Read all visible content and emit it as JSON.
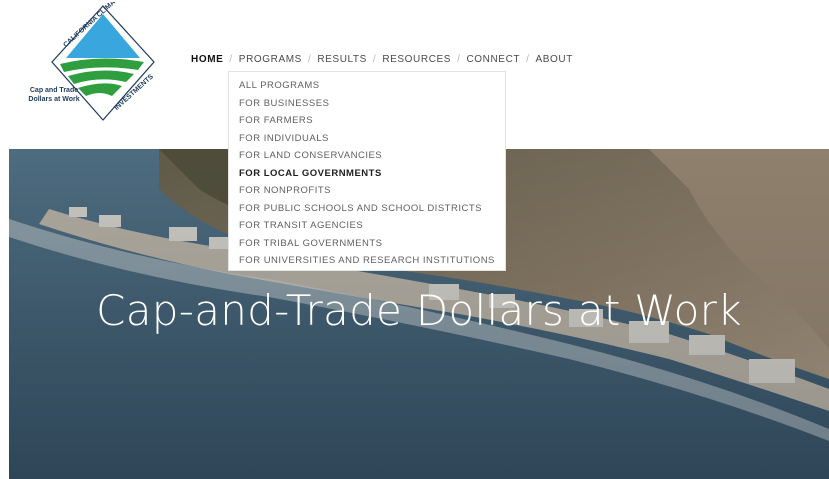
{
  "logo": {
    "name_top": "CALIFORNIA CLIMATE",
    "name_bottom": "INVESTMENTS",
    "tagline_line1": "Cap and Trade",
    "tagline_line2": "Dollars at Work"
  },
  "nav": {
    "items": [
      {
        "label": "HOME",
        "active": true
      },
      {
        "label": "PROGRAMS"
      },
      {
        "label": "RESULTS"
      },
      {
        "label": "RESOURCES"
      },
      {
        "label": "CONNECT"
      },
      {
        "label": "ABOUT"
      }
    ],
    "separator": "/"
  },
  "programs_menu": {
    "items": [
      "ALL PROGRAMS",
      "FOR BUSINESSES",
      "FOR FARMERS",
      "FOR INDIVIDUALS",
      "FOR LAND CONSERVANCIES",
      "FOR LOCAL GOVERNMENTS",
      "FOR NONPROFITS",
      "FOR PUBLIC SCHOOLS AND SCHOOL DISTRICTS",
      "FOR TRANSIT AGENCIES",
      "FOR TRIBAL GOVERNMENTS",
      "FOR UNIVERSITIES AND RESEARCH INSTITUTIONS"
    ],
    "highlighted_index": 5
  },
  "hero": {
    "title": "Cap-and-Trade Dollars at Work"
  },
  "colors": {
    "logo_blue": "#3aa6de",
    "logo_green": "#2e9e3e",
    "logo_navy": "#1d3b5c",
    "ocean": "#4e6f86",
    "hillside": "#8a7a66"
  }
}
